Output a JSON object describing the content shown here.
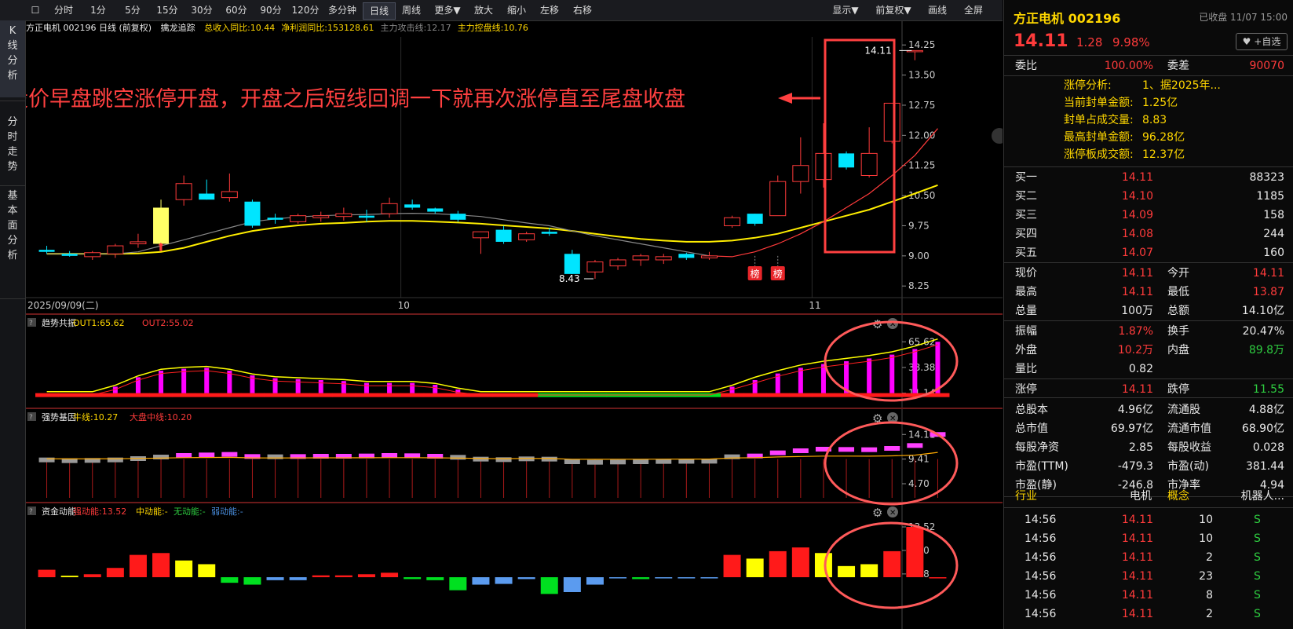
{
  "toolbar": {
    "left_items": [
      "分时",
      "1分",
      "5分",
      "15分",
      "30分",
      "60分",
      "90分",
      "120分",
      "多分钟",
      "日线",
      "周线",
      "更多▼",
      "放大",
      "缩小",
      "左移",
      "右移"
    ],
    "active": "日线",
    "right_items": [
      "显示▼",
      "前复权▼",
      "画线",
      "全屏"
    ]
  },
  "leftnav": [
    {
      "label": "K\n线\n分\n析",
      "active": true
    },
    {
      "label": "分\n时\n走\n势",
      "active": false
    },
    {
      "label": "基\n本\n面\n分\n析",
      "active": false
    }
  ],
  "main_head": {
    "title": "方正电机 002196 日线",
    "adjust": "(前复权)",
    "indicator": "擒龙追踪",
    "items": [
      {
        "text": "总收入同比:10.44",
        "color": "#ffd700"
      },
      {
        "text": "净利润同比:153128.61",
        "color": "#ffd700"
      },
      {
        "text": "主力攻击线:12.17",
        "color": "#888888"
      },
      {
        "text": "主力控盘线:10.76",
        "color": "#ffd700"
      }
    ]
  },
  "annotation": {
    "text": "股价早盘跳空涨停开盘，开盘之后短线回调一下就再次涨停直至尾盘收盘",
    "color": "#ff4040"
  },
  "chart_data": [
    {
      "type": "candlestick",
      "name": "price",
      "y_axis_ticks": [
        14.25,
        13.5,
        12.75,
        12.0,
        11.25,
        10.5,
        9.75,
        9.0,
        8.25
      ],
      "ylim": [
        8.0,
        14.45
      ],
      "x_labels": [
        {
          "text": "2025/09/09(二)",
          "index": 0
        },
        {
          "text": "10",
          "index": 16
        },
        {
          "text": "11",
          "index": 34
        }
      ],
      "max_label": "14.11",
      "min_label": "8.43",
      "badges": [
        {
          "text": "榜",
          "index": 31
        },
        {
          "text": "榜",
          "index": 32
        }
      ],
      "candles": [
        {
          "o": 9.15,
          "h": 9.25,
          "l": 9.05,
          "c": 9.1
        },
        {
          "o": 9.05,
          "h": 9.12,
          "l": 8.98,
          "c": 9.0
        },
        {
          "o": 8.98,
          "h": 9.12,
          "l": 8.9,
          "c": 9.08
        },
        {
          "o": 9.05,
          "h": 9.3,
          "l": 8.95,
          "c": 9.25
        },
        {
          "o": 9.3,
          "h": 9.55,
          "l": 9.2,
          "c": 9.35
        },
        {
          "o": 9.3,
          "h": 10.4,
          "l": 9.3,
          "c": 10.2
        },
        {
          "o": 10.4,
          "h": 11.0,
          "l": 10.25,
          "c": 10.8
        },
        {
          "o": 10.55,
          "h": 10.9,
          "l": 10.4,
          "c": 10.4
        },
        {
          "o": 10.45,
          "h": 11.05,
          "l": 10.35,
          "c": 10.6
        },
        {
          "o": 10.35,
          "h": 10.4,
          "l": 9.7,
          "c": 9.75
        },
        {
          "o": 9.95,
          "h": 10.05,
          "l": 9.8,
          "c": 9.9
        },
        {
          "o": 9.85,
          "h": 10.05,
          "l": 9.8,
          "c": 10.0
        },
        {
          "o": 9.95,
          "h": 10.1,
          "l": 9.85,
          "c": 10.0
        },
        {
          "o": 9.98,
          "h": 10.2,
          "l": 9.88,
          "c": 10.05
        },
        {
          "o": 10.0,
          "h": 10.15,
          "l": 9.85,
          "c": 9.95
        },
        {
          "o": 10.05,
          "h": 10.45,
          "l": 9.95,
          "c": 10.3
        },
        {
          "o": 10.28,
          "h": 10.4,
          "l": 10.15,
          "c": 10.2
        },
        {
          "o": 10.18,
          "h": 10.2,
          "l": 10.05,
          "c": 10.1
        },
        {
          "o": 10.05,
          "h": 10.12,
          "l": 9.85,
          "c": 9.9
        },
        {
          "o": 9.45,
          "h": 9.6,
          "l": 9.05,
          "c": 9.6
        },
        {
          "o": 9.65,
          "h": 9.75,
          "l": 9.3,
          "c": 9.35
        },
        {
          "o": 9.4,
          "h": 9.6,
          "l": 9.35,
          "c": 9.55
        },
        {
          "o": 9.6,
          "h": 9.7,
          "l": 9.5,
          "c": 9.55
        },
        {
          "o": 9.05,
          "h": 9.15,
          "l": 8.55,
          "c": 8.55
        },
        {
          "o": 8.6,
          "h": 8.9,
          "l": 8.43,
          "c": 8.85
        },
        {
          "o": 8.75,
          "h": 8.95,
          "l": 8.65,
          "c": 8.9
        },
        {
          "o": 8.9,
          "h": 9.05,
          "l": 8.75,
          "c": 9.0
        },
        {
          "o": 8.9,
          "h": 9.05,
          "l": 8.8,
          "c": 8.98
        },
        {
          "o": 9.05,
          "h": 9.08,
          "l": 8.9,
          "c": 8.95
        },
        {
          "o": 8.95,
          "h": 9.1,
          "l": 8.9,
          "c": 9.0
        },
        {
          "o": 9.75,
          "h": 10.0,
          "l": 9.7,
          "c": 9.95
        },
        {
          "o": 10.05,
          "h": 10.05,
          "l": 9.75,
          "c": 9.8
        },
        {
          "o": 10.0,
          "h": 11.0,
          "l": 10.0,
          "c": 10.85
        },
        {
          "o": 10.85,
          "h": 11.95,
          "l": 10.55,
          "c": 11.25
        },
        {
          "o": 10.9,
          "h": 12.3,
          "l": 10.7,
          "c": 11.55
        },
        {
          "o": 11.55,
          "h": 11.6,
          "l": 11.15,
          "c": 11.2
        },
        {
          "o": 11.0,
          "h": 12.2,
          "l": 10.95,
          "c": 11.55
        },
        {
          "o": 11.85,
          "h": 12.8,
          "l": 11.8,
          "c": 12.8
        },
        {
          "o": 14.11,
          "h": 14.11,
          "l": 13.87,
          "c": 14.11
        }
      ],
      "ma_attack": [
        9.05,
        9.05,
        9.05,
        9.05,
        9.1,
        9.25,
        9.4,
        9.55,
        9.7,
        9.85,
        9.92,
        9.97,
        10.0,
        10.02,
        10.03,
        10.05,
        10.06,
        10.05,
        10.02,
        9.98,
        9.9,
        9.82,
        9.75,
        9.62,
        9.5,
        9.4,
        9.3,
        9.2,
        9.1,
        9.0,
        8.98,
        9.1,
        9.3,
        9.55,
        9.85,
        10.2,
        10.55,
        11.0,
        11.5,
        12.17
      ],
      "ma_control": [
        9.05,
        9.05,
        9.05,
        9.05,
        9.06,
        9.1,
        9.2,
        9.35,
        9.5,
        9.62,
        9.7,
        9.76,
        9.8,
        9.82,
        9.85,
        9.87,
        9.87,
        9.85,
        9.83,
        9.8,
        9.76,
        9.72,
        9.68,
        9.62,
        9.55,
        9.48,
        9.42,
        9.38,
        9.35,
        9.35,
        9.38,
        9.45,
        9.55,
        9.7,
        9.85,
        10.0,
        10.15,
        10.35,
        10.55,
        10.76
      ]
    },
    {
      "type": "bar",
      "name": "趋势共振",
      "header": [
        {
          "text": "趋势共振",
          "color": "#e8e8e8"
        },
        {
          "text": "OUT1:65.62",
          "color": "#ffd700"
        },
        {
          "text": "OUT2:55.02",
          "color": "#ff3b3b"
        }
      ],
      "y_axis_ticks": [
        65.62,
        38.38,
        11.14
      ],
      "ylim": [
        0,
        75
      ],
      "values": [
        11.14,
        11.14,
        11.14,
        18,
        28,
        35,
        37,
        38,
        35,
        30,
        27,
        26,
        25,
        24,
        22,
        22,
        22,
        20,
        15,
        11.14,
        11.14,
        11.14,
        11.14,
        11.14,
        11.14,
        11.14,
        11.14,
        11.14,
        11.14,
        11.14,
        18,
        25,
        32,
        38,
        42,
        45,
        48,
        52,
        58,
        65.62
      ],
      "ribbon": [
        "red",
        "red",
        "red",
        "red",
        "red",
        "red",
        "red",
        "red",
        "red",
        "red",
        "red",
        "red",
        "red",
        "red",
        "red",
        "red",
        "red",
        "red",
        "red",
        "red",
        "red",
        "red",
        "green",
        "green",
        "green",
        "green",
        "green",
        "green",
        "green",
        "green",
        "red",
        "red",
        "red",
        "red",
        "red",
        "red",
        "red",
        "red",
        "red",
        "red"
      ]
    },
    {
      "type": "bar",
      "name": "强势基因",
      "header": [
        {
          "text": "强势基因",
          "color": "#e8e8e8"
        },
        {
          "text": "牛线:10.27",
          "color": "#ffd700"
        },
        {
          "text": "大盘中线:10.20",
          "color": "#ff3b3b"
        }
      ],
      "y_axis_ticks": [
        14.11,
        9.41,
        4.7
      ],
      "ylim": [
        2,
        15.5
      ],
      "values": [
        9.25,
        9.1,
        9.15,
        9.25,
        9.5,
        9.8,
        10.1,
        10.2,
        10.3,
        9.9,
        9.85,
        9.9,
        9.95,
        9.95,
        10.0,
        10.1,
        10.05,
        9.95,
        9.75,
        9.4,
        9.3,
        9.45,
        9.4,
        8.9,
        8.8,
        8.85,
        8.9,
        8.95,
        8.98,
        9.0,
        9.85,
        10.0,
        10.6,
        11.0,
        11.3,
        11.25,
        11.2,
        11.45,
        12.0,
        14.11
      ]
    },
    {
      "type": "bar",
      "name": "资金动能",
      "header": [
        {
          "text": "资金动能",
          "color": "#e8e8e8"
        },
        {
          "text": "强动能:13.52",
          "color": "#ff3b3b"
        },
        {
          "text": "中动能:-",
          "color": "#ffd700"
        },
        {
          "text": "无动能:-",
          "color": "#2ecc40"
        },
        {
          "text": "弱动能:-",
          "color": "#4a90e2"
        }
      ],
      "y_axis_ticks": [
        13.52,
        7.2,
        0.88
      ],
      "ylim": [
        -4,
        15
      ],
      "values": [
        2.0,
        0.4,
        0.8,
        2.5,
        6.0,
        6.5,
        4.5,
        3.5,
        -1.5,
        -2.0,
        -0.8,
        -0.8,
        0.5,
        0.5,
        0.8,
        1.2,
        -0.5,
        -0.8,
        -3.5,
        -2.0,
        -1.8,
        -0.5,
        -4.5,
        -4.0,
        -2.0,
        -0.3,
        -0.5,
        -0.3,
        -0.2,
        -0.2,
        6.0,
        5.0,
        7.0,
        8.0,
        6.5,
        3.0,
        3.5,
        7.0,
        13.52,
        0
      ],
      "colors": [
        "red",
        "yellow",
        "red",
        "red",
        "red",
        "red",
        "yellow",
        "yellow",
        "green",
        "green",
        "blue",
        "blue",
        "red",
        "red",
        "red",
        "red",
        "green",
        "green",
        "green",
        "blue",
        "blue",
        "blue",
        "green",
        "blue",
        "blue",
        "blue",
        "green",
        "blue",
        "blue",
        "blue",
        "red",
        "yellow",
        "red",
        "red",
        "yellow",
        "yellow",
        "yellow",
        "red",
        "red",
        "red"
      ]
    }
  ],
  "right": {
    "title": "方正电机 002196",
    "status": "已收盘 11/07 15:00",
    "price": "14.11",
    "change": "1.28",
    "pct": "9.98%",
    "add_fav": "+自选",
    "weibi_label": "委比",
    "weibi_value": "100.00%",
    "weicha_label": "委差",
    "weicha_value": "90070",
    "limit_info": [
      {
        "label": "涨停分析:",
        "value": "1、据2025年..."
      },
      {
        "label": "当前封单金额:",
        "value": "1.25亿"
      },
      {
        "label": "封单占成交量:",
        "value": "8.83"
      },
      {
        "label": "最高封单金额:",
        "value": "96.28亿"
      },
      {
        "label": "涨停板成交额:",
        "value": "12.37亿"
      }
    ],
    "buys": [
      {
        "label": "买一",
        "price": "14.11",
        "vol": "88323"
      },
      {
        "label": "买二",
        "price": "14.10",
        "vol": "1185"
      },
      {
        "label": "买三",
        "price": "14.09",
        "vol": "158"
      },
      {
        "label": "买四",
        "price": "14.08",
        "vol": "244"
      },
      {
        "label": "买五",
        "price": "14.07",
        "vol": "160"
      }
    ],
    "stats": [
      [
        {
          "l": "现价",
          "v": "14.11",
          "c": "red"
        },
        {
          "l": "今开",
          "v": "14.11",
          "c": "red"
        }
      ],
      [
        {
          "l": "最高",
          "v": "14.11",
          "c": "red"
        },
        {
          "l": "最低",
          "v": "13.87",
          "c": "red"
        }
      ],
      [
        {
          "l": "总量",
          "v": "100万",
          "c": "white"
        },
        {
          "l": "总额",
          "v": "14.10亿",
          "c": "white"
        }
      ],
      [
        {
          "l": "振幅",
          "v": "1.87%",
          "c": "red"
        },
        {
          "l": "换手",
          "v": "20.47%",
          "c": "white"
        }
      ],
      [
        {
          "l": "外盘",
          "v": "10.2万",
          "c": "red"
        },
        {
          "l": "内盘",
          "v": "89.8万",
          "c": "green"
        }
      ],
      [
        {
          "l": "量比",
          "v": "0.82",
          "c": "white"
        },
        {
          "l": "",
          "v": "",
          "c": "white"
        }
      ],
      [
        {
          "l": "涨停",
          "v": "14.11",
          "c": "red"
        },
        {
          "l": "跌停",
          "v": "11.55",
          "c": "green"
        }
      ],
      [
        {
          "l": "总股本",
          "v": "4.96亿",
          "c": "white"
        },
        {
          "l": "流通股",
          "v": "4.88亿",
          "c": "white"
        }
      ],
      [
        {
          "l": "总市值",
          "v": "69.97亿",
          "c": "white"
        },
        {
          "l": "流通市值",
          "v": "68.90亿",
          "c": "white"
        }
      ],
      [
        {
          "l": "每股净资",
          "v": "2.85",
          "c": "white"
        },
        {
          "l": "每股收益",
          "v": "0.028",
          "c": "white"
        }
      ],
      [
        {
          "l": "市盈(TTM)",
          "v": "-479.3",
          "c": "white"
        },
        {
          "l": "市盈(动)",
          "v": "381.44",
          "c": "white"
        }
      ],
      [
        {
          "l": "市盈(静)",
          "v": "-246.8",
          "c": "white"
        },
        {
          "l": "市净率",
          "v": "4.94",
          "c": "white"
        }
      ]
    ],
    "industry": {
      "l1": "行业",
      "v1": "电机",
      "l2": "概念",
      "v2": "机器人..."
    },
    "ticks": [
      {
        "t": "14:56",
        "p": "14.11",
        "v": "10",
        "d": "S"
      },
      {
        "t": "14:56",
        "p": "14.11",
        "v": "10",
        "d": "S"
      },
      {
        "t": "14:56",
        "p": "14.11",
        "v": "2",
        "d": "S"
      },
      {
        "t": "14:56",
        "p": "14.11",
        "v": "23",
        "d": "S"
      },
      {
        "t": "14:56",
        "p": "14.11",
        "v": "8",
        "d": "S"
      },
      {
        "t": "14:56",
        "p": "14.11",
        "v": "2",
        "d": "S"
      }
    ]
  }
}
